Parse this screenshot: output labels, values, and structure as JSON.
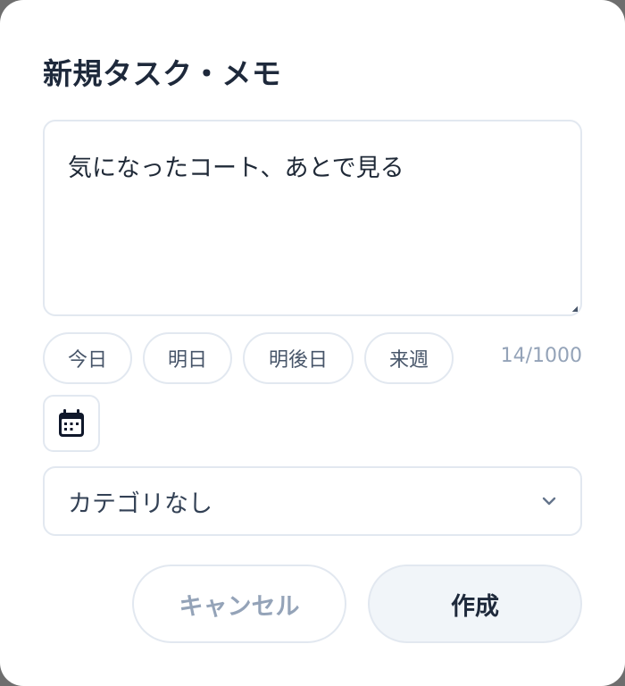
{
  "dialog": {
    "title": "新規タスク・メモ",
    "memo": {
      "value": "気になったコート、あとで見る"
    },
    "date_chips": [
      {
        "label": "今日"
      },
      {
        "label": "明日"
      },
      {
        "label": "明後日"
      },
      {
        "label": "来週"
      }
    ],
    "char_counter": "14/1000",
    "calendar_button": {
      "icon": "calendar-icon"
    },
    "category_select": {
      "selected": "カテゴリなし",
      "icon": "chevron-down-icon"
    },
    "actions": {
      "cancel_label": "キャンセル",
      "create_label": "作成"
    }
  }
}
